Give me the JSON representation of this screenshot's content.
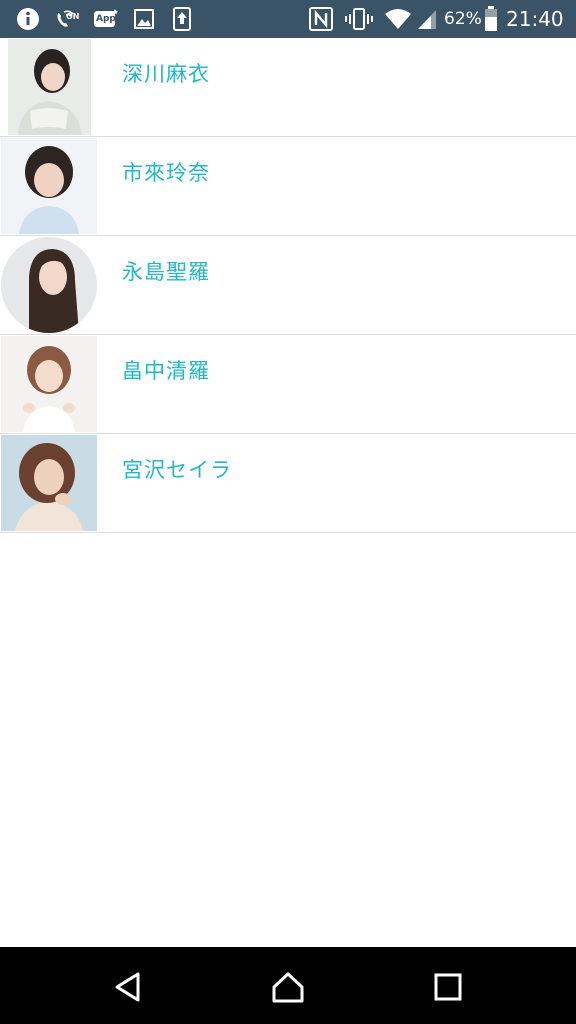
{
  "status_bar": {
    "left_icons": [
      "info-icon",
      "wifi-calling-icon",
      "app-notification-icon",
      "image-icon",
      "upload-icon"
    ],
    "app_badge": "App",
    "wifi_call_badge": "ON",
    "right_icons": [
      "nfc-icon",
      "vibrate-icon",
      "wifi-icon",
      "signal-icon",
      "battery-icon"
    ],
    "battery_percent": "62%",
    "time": "21:40",
    "background_color": "#3a5366"
  },
  "list": {
    "name_color": "#22b8c8",
    "items": [
      {
        "name": "深川麻衣",
        "avatar_icon": "portrait-avatar"
      },
      {
        "name": "市來玲奈",
        "avatar_icon": "portrait-avatar"
      },
      {
        "name": "永島聖羅",
        "avatar_icon": "portrait-avatar-round"
      },
      {
        "name": "畠中清羅",
        "avatar_icon": "portrait-avatar"
      },
      {
        "name": "宮沢セイラ",
        "avatar_icon": "portrait-avatar"
      }
    ]
  },
  "nav_bar": {
    "buttons": [
      "back-icon",
      "home-icon",
      "recents-icon"
    ]
  }
}
